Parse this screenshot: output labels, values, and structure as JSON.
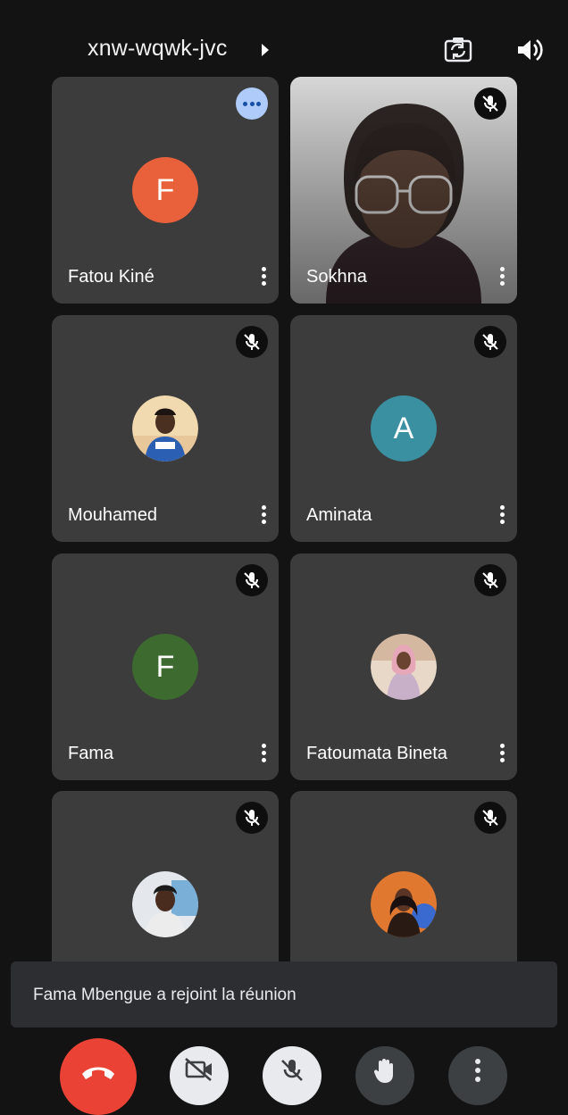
{
  "header": {
    "meeting_code": "xnw-wqwk-jvc",
    "icons": [
      "chevron-right-icon",
      "switch-camera-icon",
      "speaker-icon"
    ]
  },
  "participants": [
    {
      "name": "Fatou Kiné",
      "initial": "F",
      "avatar_color": "#e8613a",
      "muted": false,
      "has_more_button": true
    },
    {
      "name": "Sokhna",
      "video": true,
      "muted": true
    },
    {
      "name": "Mouhamed",
      "photo": true,
      "muted": true
    },
    {
      "name": "Aminata",
      "initial": "A",
      "avatar_color": "#3a8fa0",
      "muted": true
    },
    {
      "name": "Fama",
      "initial": "F",
      "avatar_color": "#3d6b2f",
      "muted": true
    },
    {
      "name": "Fatoumata Bineta",
      "photo": true,
      "muted": true
    },
    {
      "name": "",
      "photo": true,
      "muted": true
    },
    {
      "name": "",
      "photo": true,
      "muted": true
    }
  ],
  "toast": {
    "message": "Fama Mbengue a rejoint la réunion"
  },
  "controls": {
    "icons": [
      "end-call-icon",
      "camera-off-icon",
      "mic-off-icon",
      "raise-hand-icon",
      "more-vert-icon"
    ],
    "end_call_color": "#ea4335"
  }
}
